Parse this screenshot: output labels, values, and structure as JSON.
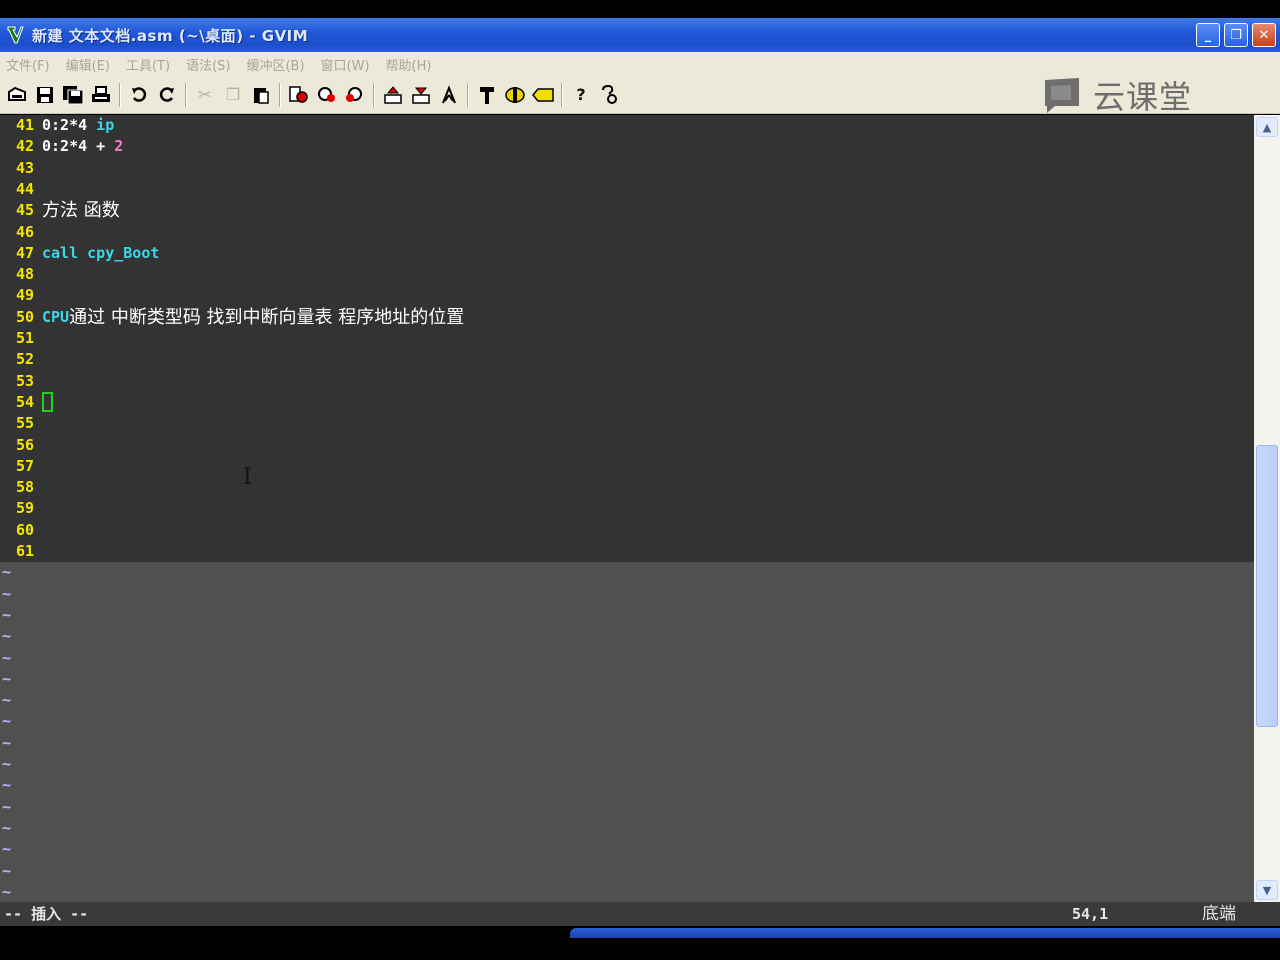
{
  "window": {
    "title": "新建 文本文档.asm (~\\桌面) - GVIM",
    "buttons": {
      "minimize": "_",
      "restore": "❐",
      "close": "✕"
    }
  },
  "menu": [
    "文件(F)",
    "编辑(E)",
    "工具(T)",
    "语法(S)",
    "缓冲区(B)",
    "窗口(W)",
    "帮助(H)"
  ],
  "toolbar": {
    "icons": [
      "open-icon",
      "save-icon",
      "save-all-icon",
      "print-icon",
      "undo-icon",
      "redo-icon",
      "cut-icon",
      "copy-icon",
      "paste-icon",
      "find-replace-icon",
      "find-next-icon",
      "find-prev-icon",
      "load-session-icon",
      "save-session-icon",
      "run-script-icon",
      "make-icon",
      "shell-icon",
      "ctags-icon",
      "help-icon",
      "find-help-icon"
    ]
  },
  "watermark": {
    "text": "云课堂"
  },
  "editor": {
    "lines": [
      {
        "num": "41",
        "segments": [
          [
            "white",
            "0:2*4"
          ],
          [
            "cyan",
            " ip"
          ]
        ]
      },
      {
        "num": "42",
        "segments": [
          [
            "white",
            "0:2*4"
          ],
          [
            "white",
            " + "
          ],
          [
            "pink",
            "2"
          ]
        ]
      },
      {
        "num": "43",
        "segments": []
      },
      {
        "num": "44",
        "segments": []
      },
      {
        "num": "45",
        "segments": [
          [
            "zh",
            "方法 函数"
          ]
        ]
      },
      {
        "num": "46",
        "segments": []
      },
      {
        "num": "47",
        "segments": [
          [
            "cyan",
            "call cpy_Boot"
          ]
        ]
      },
      {
        "num": "48",
        "segments": []
      },
      {
        "num": "49",
        "segments": []
      },
      {
        "num": "50",
        "segments": [
          [
            "cyan",
            "CPU"
          ],
          [
            "zh",
            "通过 中断类型码 找到中断向量表 程序地址的位置"
          ]
        ]
      },
      {
        "num": "51",
        "segments": []
      },
      {
        "num": "52",
        "segments": []
      },
      {
        "num": "53",
        "segments": []
      },
      {
        "num": "54",
        "segments": [],
        "cursor": true
      },
      {
        "num": "55",
        "segments": []
      },
      {
        "num": "56",
        "segments": []
      },
      {
        "num": "57",
        "segments": []
      },
      {
        "num": "58",
        "segments": []
      },
      {
        "num": "59",
        "segments": []
      },
      {
        "num": "60",
        "segments": []
      },
      {
        "num": "61",
        "segments": []
      }
    ],
    "tilde": "~",
    "tilde_count": 16
  },
  "status": {
    "mode": "-- 插入 --",
    "position": "54,1",
    "where": "底端"
  },
  "colors": {
    "line_number": "#f5e600",
    "keyword": "#3fd6e6",
    "number": "#ff7ad0",
    "cursor": "#20d020"
  }
}
